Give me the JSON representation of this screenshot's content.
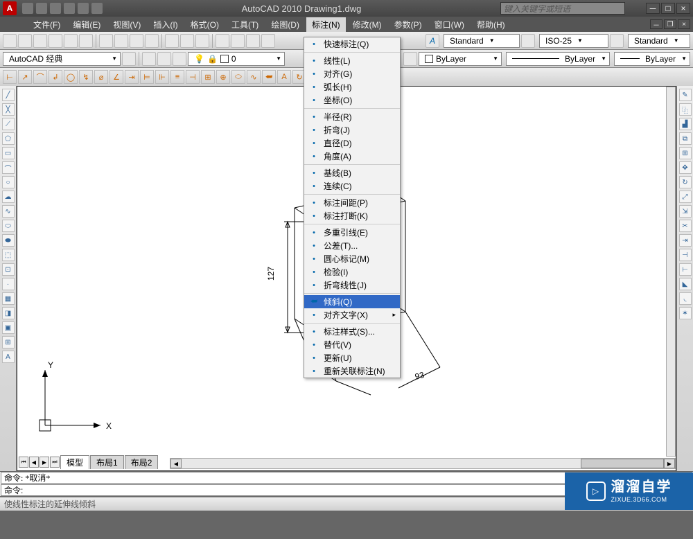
{
  "titlebar": {
    "app_title": "AutoCAD 2010   Drawing1.dwg",
    "search_placeholder": "键入关键字或短语",
    "logo_letter": "A"
  },
  "menus": {
    "items": [
      "文件(F)",
      "编辑(E)",
      "视图(V)",
      "插入(I)",
      "格式(O)",
      "工具(T)",
      "绘图(D)",
      "标注(N)",
      "修改(M)",
      "参数(P)",
      "窗口(W)",
      "帮助(H)"
    ],
    "active_index": 7
  },
  "style_row": {
    "text_style": "Standard",
    "dim_style": "ISO-25",
    "table_style": "Standard"
  },
  "layer_row": {
    "workspace": "AutoCAD 经典",
    "layer": "0",
    "color_label": "ByLayer",
    "linetype_label": "ByLayer",
    "lineweight_label": "ByLayer"
  },
  "dimension_menu": {
    "items": [
      {
        "label": "快速标注(Q)",
        "sep_after": true
      },
      {
        "label": "线性(L)"
      },
      {
        "label": "对齐(G)"
      },
      {
        "label": "弧长(H)"
      },
      {
        "label": "坐标(O)",
        "sep_after": true
      },
      {
        "label": "半径(R)"
      },
      {
        "label": "折弯(J)"
      },
      {
        "label": "直径(D)"
      },
      {
        "label": "角度(A)",
        "sep_after": true
      },
      {
        "label": "基线(B)"
      },
      {
        "label": "连续(C)",
        "sep_after": true
      },
      {
        "label": "标注间距(P)"
      },
      {
        "label": "标注打断(K)",
        "sep_after": true
      },
      {
        "label": "多重引线(E)"
      },
      {
        "label": "公差(T)..."
      },
      {
        "label": "圆心标记(M)"
      },
      {
        "label": "检验(I)"
      },
      {
        "label": "折弯线性(J)",
        "sep_after": true
      },
      {
        "label": "倾斜(Q)",
        "highlight": true
      },
      {
        "label": "对齐文字(X)",
        "submenu": true,
        "sep_after": true
      },
      {
        "label": "标注样式(S)..."
      },
      {
        "label": "替代(V)"
      },
      {
        "label": "更新(U)"
      },
      {
        "label": "重新关联标注(N)"
      }
    ]
  },
  "tabs": {
    "model": "模型",
    "layout1": "布局1",
    "layout2": "布局2"
  },
  "ucs": {
    "x": "X",
    "y": "Y"
  },
  "dims": {
    "a": "127",
    "b": "93"
  },
  "command": {
    "prev": "命令: *取消*",
    "current_prompt": "命令:"
  },
  "status": {
    "hint": "使线性标注的延伸线倾斜"
  },
  "watermark": {
    "brand": "溜溜自学",
    "url": "ZIXUE.3D66.COM",
    "play": "▷"
  }
}
